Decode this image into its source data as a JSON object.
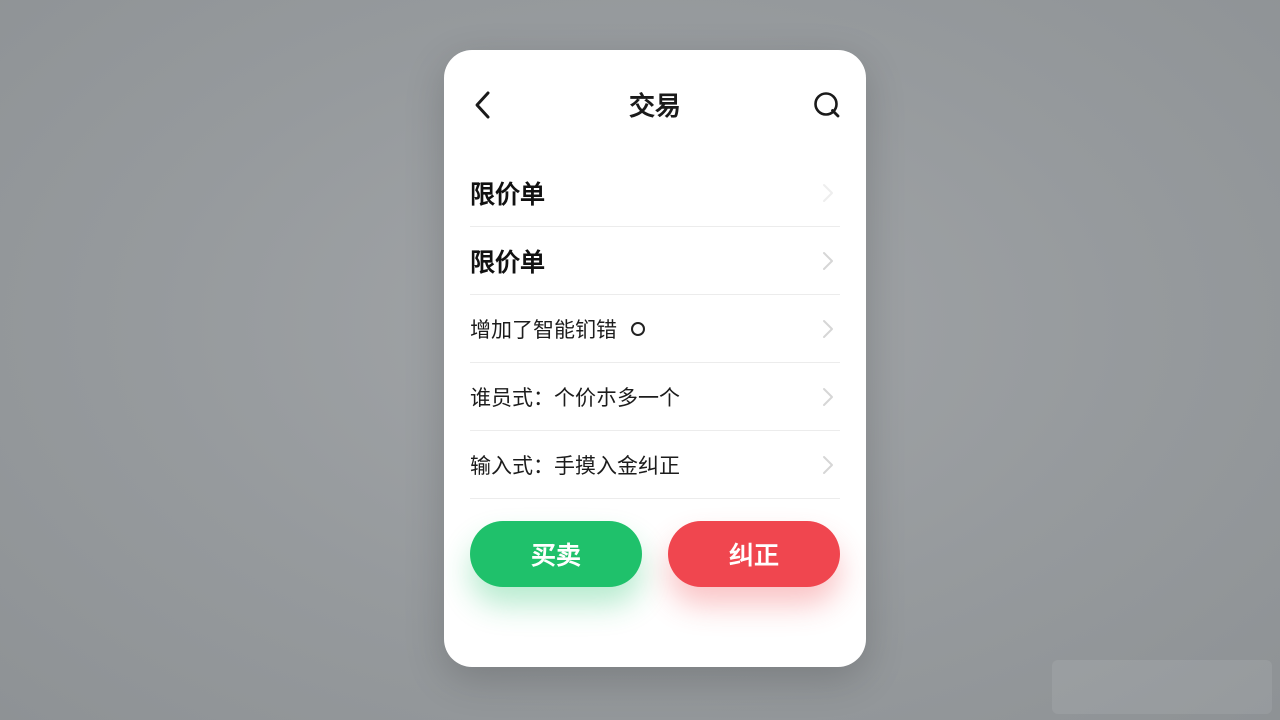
{
  "header": {
    "title": "交易",
    "back_icon": "chevron-left-icon",
    "search_icon": "search-icon"
  },
  "list": {
    "items": [
      {
        "label": "限价单",
        "emphasis": "bold"
      },
      {
        "label": "限价单",
        "emphasis": "bold"
      },
      {
        "label": "增加了智能钔错",
        "has_dot": true
      },
      {
        "label": "谁员式：个价朩多一个"
      },
      {
        "label": "输入式：手摸入金纠正"
      }
    ]
  },
  "actions": {
    "buy_label": "买卖",
    "fix_label": "纠正"
  },
  "colors": {
    "buy": "#1fc16b",
    "fix": "#f0464f",
    "background": "#979a9d",
    "card": "#ffffff"
  }
}
